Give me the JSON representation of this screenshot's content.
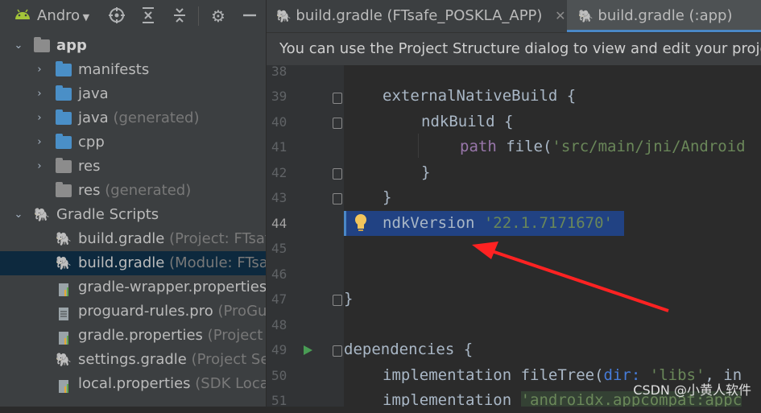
{
  "project_toolbar": {
    "dropdown_label": "Andro"
  },
  "tree": [
    {
      "label": "app",
      "extra": ""
    },
    {
      "label": "manifests",
      "extra": ""
    },
    {
      "label": "java",
      "extra": ""
    },
    {
      "label": "java",
      "extra": "(generated)"
    },
    {
      "label": "cpp",
      "extra": ""
    },
    {
      "label": "res",
      "extra": ""
    },
    {
      "label": "res",
      "extra": "(generated)"
    },
    {
      "label": "Gradle Scripts",
      "extra": ""
    },
    {
      "label": "build.gradle",
      "extra": "(Project: FTsafe"
    },
    {
      "label": "build.gradle",
      "extra": "(Module: FTsa"
    },
    {
      "label": "gradle-wrapper.properties",
      "extra": ""
    },
    {
      "label": "proguard-rules.pro",
      "extra": "(ProGua"
    },
    {
      "label": "gradle.properties",
      "extra": "(Project P"
    },
    {
      "label": "settings.gradle",
      "extra": "(Project Set"
    },
    {
      "label": "local.properties",
      "extra": "(SDK Locati"
    }
  ],
  "tabs": [
    {
      "label": "build.gradle (FTsafe_POSKLA_APP)"
    },
    {
      "label": "build.gradle (:app)"
    }
  ],
  "banner": "You can use the Project Structure dialog to view and edit your project",
  "lines": {
    "n38": "38",
    "n39": "39",
    "n40": "40",
    "n41": "41",
    "n42": "42",
    "n43": "43",
    "n44": "44",
    "n45": "45",
    "n46": "46",
    "n47": "47",
    "n48": "48",
    "n49": "49",
    "n50": "50",
    "n51": "51"
  },
  "code": {
    "l39": "externalNativeBuild {",
    "l40": "ndkBuild {",
    "l41_kw": "path",
    "l41_fn": " file(",
    "l41_str": "'src/main/jni/Android",
    "l42": "}",
    "l43": "}",
    "l44_kw": "ndkVersion ",
    "l44_str": "'22.1.7171670'",
    "l47": "}",
    "l49": "dependencies {",
    "l50_a": "implementation fileTree(",
    "l50_named": "dir:",
    "l50_str": " 'libs'",
    "l50_b": ", in",
    "l51_a": "implementation ",
    "l51_str": "'androidx.appcompat:appc"
  },
  "watermark": "CSDN @小黄人软件"
}
